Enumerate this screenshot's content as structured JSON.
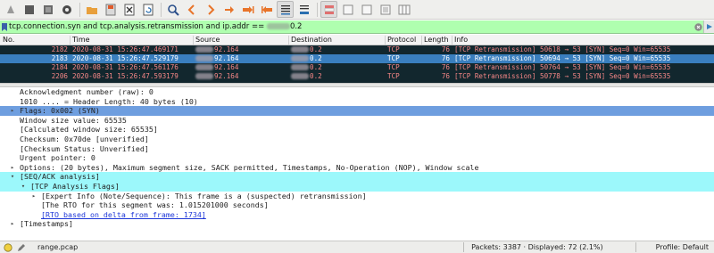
{
  "filter": {
    "value": "tcp.connection.syn and tcp.analysis.retransmission and ip.addr == ",
    "value_tail": "0.2"
  },
  "packet_list": {
    "headers": {
      "no": "No.",
      "time": "Time",
      "source": "Source",
      "destination": "Destination",
      "protocol": "Protocol",
      "length": "Length",
      "info": "Info"
    },
    "rows": [
      {
        "no": "2182",
        "time": "2020-08-31 15:26:47.469171",
        "source_tail": "92.164",
        "dest_tail": "0.2",
        "protocol": "TCP",
        "length": "76",
        "info": "[TCP Retransmission] 50618 → 53 [SYN] Seq=0 Win=65535"
      },
      {
        "no": "2183",
        "time": "2020-08-31 15:26:47.529179",
        "source_tail": "92.164",
        "dest_tail": "0.2",
        "protocol": "TCP",
        "length": "76",
        "info": "[TCP Retransmission] 50694 → 53 [SYN] Seq=0 Win=65535"
      },
      {
        "no": "2184",
        "time": "2020-08-31 15:26:47.561176",
        "source_tail": "92.164",
        "dest_tail": "0.2",
        "protocol": "TCP",
        "length": "76",
        "info": "[TCP Retransmission] 50764 → 53 [SYN] Seq=0 Win=65535"
      },
      {
        "no": "2206",
        "time": "2020-08-31 15:26:47.593179",
        "source_tail": "92.164",
        "dest_tail": "0.2",
        "protocol": "TCP",
        "length": "76",
        "info": "[TCP Retransmission] 50778 → 53 [SYN] Seq=0 Win=65535"
      }
    ]
  },
  "details": {
    "rows": [
      {
        "text": "Acknowledgment number (raw): 0"
      },
      {
        "text": "1010 .... = Header Length: 40 bytes (10)"
      },
      {
        "text": "Flags: 0x002 (SYN)"
      },
      {
        "text": "Window size value: 65535"
      },
      {
        "text": "[Calculated window size: 65535]"
      },
      {
        "text": "Checksum: 0x70de [unverified]"
      },
      {
        "text": "[Checksum Status: Unverified]"
      },
      {
        "text": "Urgent pointer: 0"
      },
      {
        "text": "Options: (20 bytes), Maximum segment size, SACK permitted, Timestamps, No-Operation (NOP), Window scale"
      },
      {
        "text": "[SEQ/ACK analysis]"
      },
      {
        "text": "[TCP Analysis Flags]"
      },
      {
        "text": "[Expert Info (Note/Sequence): This frame is a (suspected) retransmission]"
      },
      {
        "text": "[The RTO for this segment was: 1.015201000 seconds]"
      },
      {
        "text": "[RTO based on delta from frame: 1734]"
      },
      {
        "text": "[Timestamps]"
      }
    ]
  },
  "status": {
    "file": "range.pcap",
    "packets": "Packets: 3387 · Displayed: 72 (2.1%)",
    "profile": "Profile: Default"
  },
  "colors": {
    "filter_ok": "#afffaf",
    "list_bg": "#12272e",
    "retrans_fg": "#f78787",
    "selected_bg": "#3a7fbf",
    "flags_hl": "#6e9edf",
    "analysis_hl": "#9cf8fb"
  }
}
